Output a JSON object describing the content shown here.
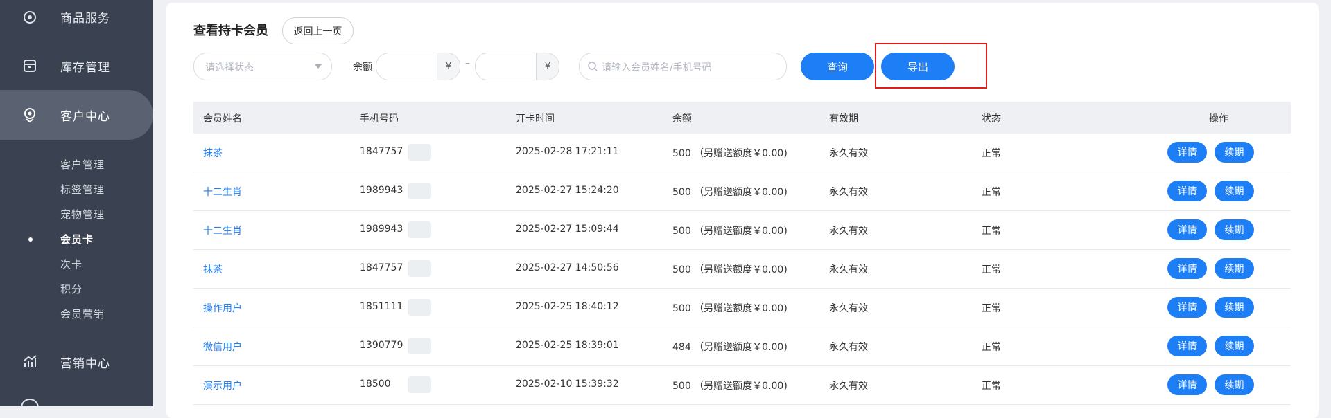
{
  "sidebar": {
    "items": [
      {
        "label": "商品服务",
        "icon": "goods-icon"
      },
      {
        "label": "库存管理",
        "icon": "inventory-icon"
      },
      {
        "label": "客户中心",
        "icon": "customer-icon"
      },
      {
        "label": "营销中心",
        "icon": "marketing-icon"
      }
    ],
    "sub_items": [
      "客户管理",
      "标签管理",
      "宠物管理",
      "会员卡",
      "次卡",
      "积分",
      "会员营销"
    ],
    "active_sub": "会员卡"
  },
  "page": {
    "title": "查看持卡会员",
    "back_label": "返回上一页"
  },
  "filters": {
    "status_placeholder": "请选择状态",
    "balance_label": "余额",
    "currency_unit": "¥",
    "range_separator": "–",
    "search_placeholder": "请输入会员姓名/手机号码",
    "query_label": "查询",
    "export_label": "导出"
  },
  "table": {
    "columns": [
      "会员姓名",
      "手机号码",
      "开卡时间",
      "余额",
      "有效期",
      "状态",
      "操作"
    ],
    "rows": [
      {
        "name": "抹茶",
        "phone": "1847757",
        "open_time": "2025-02-28 17:21:11",
        "balance": "500 （另赠送额度￥0.00)",
        "validity": "永久有效",
        "status": "正常"
      },
      {
        "name": "十二生肖",
        "phone": "1989943",
        "open_time": "2025-02-27 15:24:20",
        "balance": "500 （另赠送额度￥0.00)",
        "validity": "永久有效",
        "status": "正常"
      },
      {
        "name": "十二生肖",
        "phone": "1989943",
        "open_time": "2025-02-27 15:09:44",
        "balance": "500 （另赠送额度￥0.00)",
        "validity": "永久有效",
        "status": "正常"
      },
      {
        "name": "抹茶",
        "phone": "1847757",
        "open_time": "2025-02-27 14:50:56",
        "balance": "500 （另赠送额度￥0.00)",
        "validity": "永久有效",
        "status": "正常"
      },
      {
        "name": "操作用户",
        "phone": "1851111",
        "open_time": "2025-02-25 18:40:12",
        "balance": "500 （另赠送额度￥0.00)",
        "validity": "永久有效",
        "status": "正常"
      },
      {
        "name": "微信用户",
        "phone": "1390779",
        "open_time": "2025-02-25 18:39:01",
        "balance": "484 （另赠送额度￥0.00)",
        "validity": "永久有效",
        "status": "正常"
      },
      {
        "name": "演示用户",
        "phone": "18500",
        "open_time": "2025-02-10 15:39:32",
        "balance": "500 （另赠送额度￥0.00)",
        "validity": "永久有效",
        "status": "正常"
      }
    ],
    "action_detail": "详情",
    "action_renew": "续期"
  },
  "colors": {
    "primary": "#1e7ef5",
    "sidebar_bg": "#3a4150",
    "highlight_border": "#e51c1c"
  }
}
